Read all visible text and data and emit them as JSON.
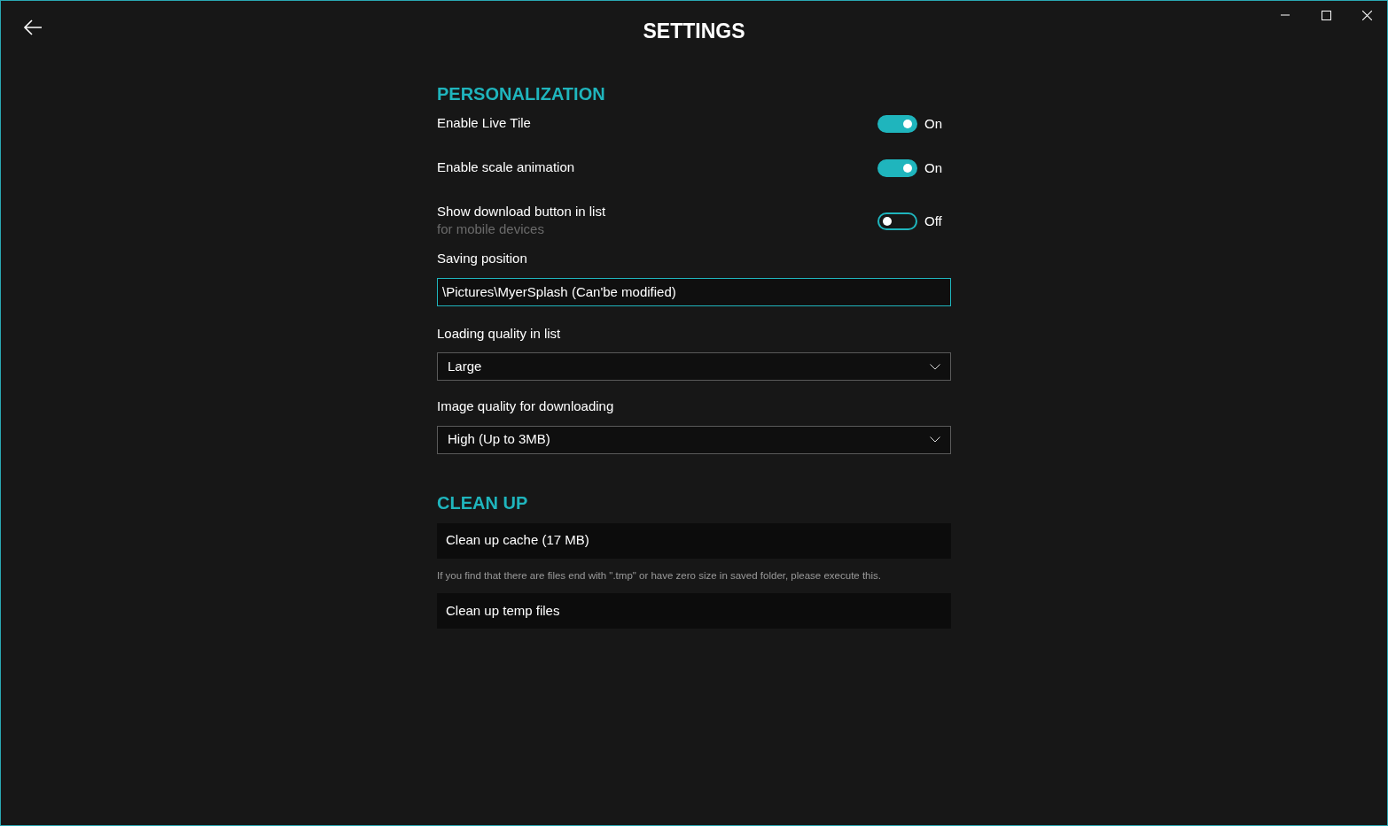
{
  "title": "SETTINGS",
  "sections": [
    {
      "heading": "PERSONALIZATION",
      "items": [
        {
          "kind": "toggle",
          "label": "Enable Live Tile",
          "on": true,
          "state_text": "On"
        },
        {
          "kind": "toggle",
          "label": "Enable scale animation",
          "on": true,
          "state_text": "On"
        },
        {
          "kind": "toggle",
          "label": "Show download button in list",
          "sublabel": "for mobile devices",
          "on": false,
          "state_text": "Off"
        },
        {
          "kind": "textfield",
          "label": "Saving position",
          "value": "\\Pictures\\MyerSplash (Can'be modified)"
        },
        {
          "kind": "dropdown",
          "label": "Loading quality in list",
          "value": "Large"
        },
        {
          "kind": "dropdown",
          "label": "Image quality for downloading",
          "value": "High (Up to 3MB)"
        }
      ]
    },
    {
      "heading": "CLEAN UP",
      "items": [
        {
          "kind": "button",
          "label": "Clean up cache (17 MB)"
        },
        {
          "kind": "note",
          "label": "If you find that there are files end with \".tmp\" or have zero size in saved folder, please execute this."
        },
        {
          "kind": "button",
          "label": "Clean up temp files"
        }
      ]
    }
  ]
}
